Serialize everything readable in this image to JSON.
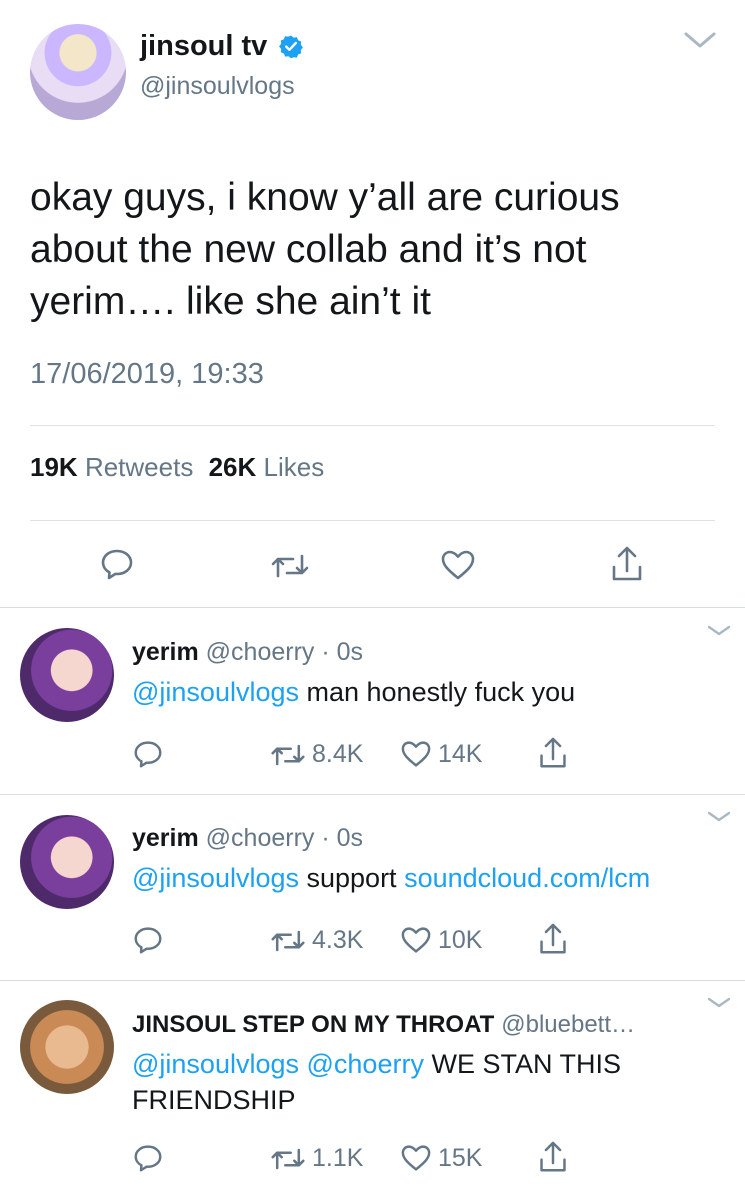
{
  "main_tweet": {
    "display_name": "jinsoul tv",
    "handle": "@jinsoulvlogs",
    "text_lines": [
      "okay guys, i know y’all are curious",
      "about the new collab and it’s not",
      "yerim…. like she ain’t it"
    ],
    "timestamp": "17/06/2019, 19:33",
    "retweets_count": "19K",
    "retweets_label": "Retweets",
    "likes_count": "26K",
    "likes_label": "Likes",
    "verified": true
  },
  "replies": [
    {
      "name": "yerim",
      "handle": "@choerry",
      "time": "0s",
      "mention": "@jinsoulvlogs",
      "text": "man honestly fuck you",
      "retweets": "8.4K",
      "likes": "14K"
    },
    {
      "name": "yerim",
      "handle": "@choerry",
      "time": "0s",
      "mention": "@jinsoulvlogs",
      "text": "support",
      "link": "soundcloud.com/lcm",
      "retweets": "4.3K",
      "likes": "10K"
    },
    {
      "name": "JINSOUL STEP ON MY THROAT",
      "handle": "@bluebett…",
      "mention1": "@jinsoulvlogs",
      "mention2": "@choerry",
      "text_line1": "WE STAN THIS",
      "text_line2": "FRIENDSHIP",
      "retweets": "1.1K",
      "likes": "15K"
    }
  ],
  "separator": "·",
  "colors": {
    "link": "#1da1f2",
    "secondary": "#657786",
    "text": "#14171a",
    "divider": "#d8dde2"
  },
  "icons": [
    "chevron-down-icon",
    "verified-badge-icon",
    "reply-icon",
    "retweet-icon",
    "like-icon",
    "share-icon"
  ]
}
